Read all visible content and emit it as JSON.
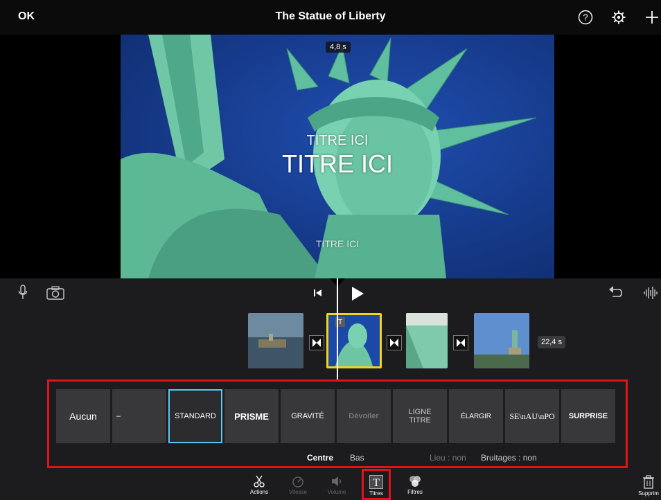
{
  "header": {
    "ok_label": "OK",
    "title": "The Statue of Liberty",
    "icons": [
      "help-icon",
      "settings-gear-icon",
      "add-plus-icon"
    ]
  },
  "preview": {
    "duration": "4,8 s",
    "title_small": "TITRE ICI",
    "title_large": "TITRE ICI",
    "title_bottom": "TITRE ICI"
  },
  "timeline": {
    "clip_duration": "22,4 s",
    "icons": [
      "microphone-icon",
      "camera-icon",
      "skip-back-icon",
      "play-icon",
      "undo-icon",
      "audio-waveform-icon"
    ]
  },
  "title_styles": {
    "items": [
      "Aucun",
      "–",
      "STANDARD",
      "PRISME",
      "GRAVITÉ",
      "Dévoiler",
      "LIGNE\nTITRE",
      "ÉLARGIR",
      "SE\\nAU\\nPO",
      "SURPRISE"
    ],
    "selected": "STANDARD",
    "options": {
      "position_center": "Centre",
      "position_bottom": "Bas",
      "location": "Lieu : non",
      "sound_effects": "Bruitages : non"
    }
  },
  "toolbar": {
    "actions": "Actions",
    "speed": "Vitesse",
    "volume": "Volume",
    "titles": "Titres",
    "filters": "Filtres",
    "delete": "Supprim"
  },
  "colors": {
    "highlight_red": "#e0131d",
    "selected_blue": "#5ac8fa",
    "clip_selected_yellow": "#f5d21c"
  }
}
